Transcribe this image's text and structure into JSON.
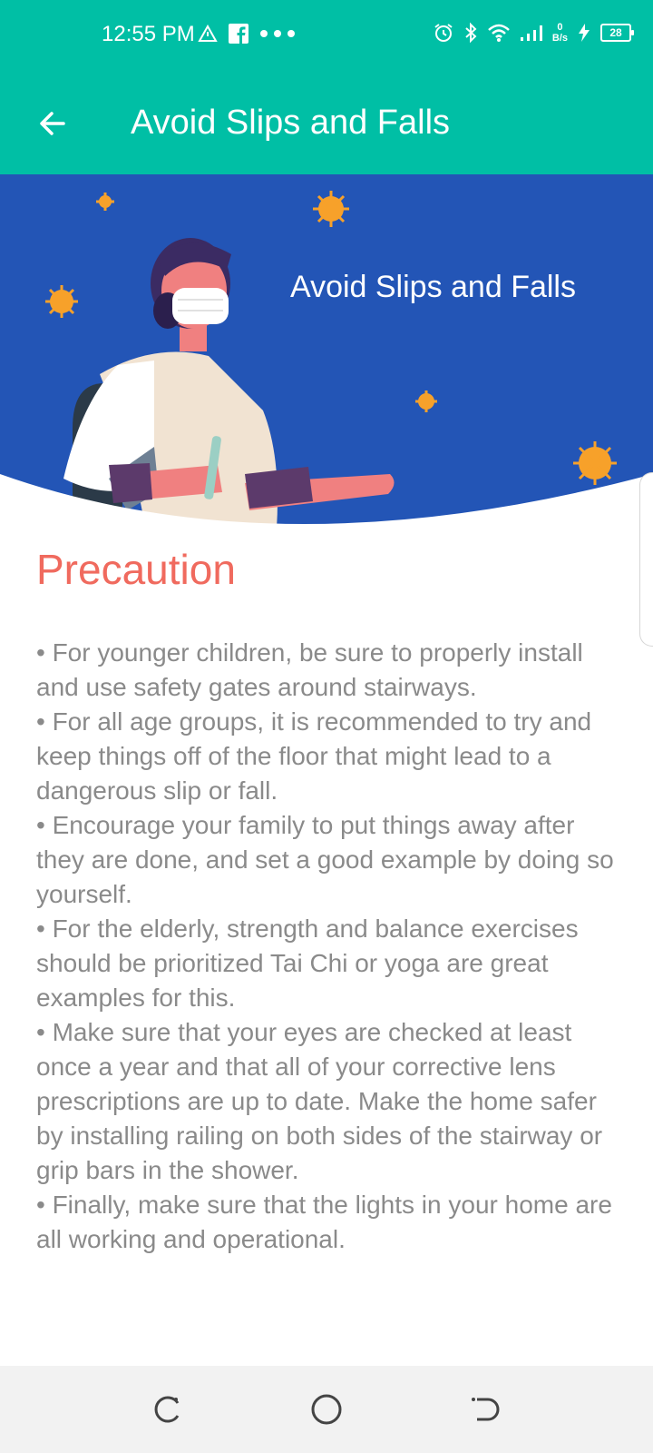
{
  "status_bar": {
    "time": "12:55 PM",
    "net_speed_value": "0",
    "net_speed_unit": "B/s",
    "battery": "28",
    "icons": [
      "warning-triangle-icon",
      "facebook-icon",
      "more-dots-icon",
      "alarm-icon",
      "bluetooth-icon",
      "wifi-icon",
      "signal-icon",
      "charging-icon",
      "battery-icon"
    ]
  },
  "app_bar": {
    "title": "Avoid Slips and Falls",
    "back_icon": "arrow-left-icon"
  },
  "banner": {
    "title": "Avoid Slips and Falls",
    "colors": {
      "background": "#2355b6",
      "virus": "#f7a12a"
    }
  },
  "content": {
    "heading": "Precaution",
    "body": "• For younger children, be sure to properly install and use safety gates around stairways.\n• For all age groups, it is recommended to try and keep things off of the floor that might lead to a dangerous slip or fall.\n• Encourage your family to put things away after they are done, and set a good example by doing so yourself.\n• For the elderly, strength and balance exercises should be prioritized Tai Chi or yoga are great examples for this.\n• Make sure that your eyes are checked at least once a year and that all of your corrective lens prescriptions are up to date. Make the home safer by installing railing on both sides of the stairway or grip bars in the shower.\n• Finally, make sure that the lights in your home are all working and operational."
  },
  "nav_bar": {
    "buttons": [
      "recents-icon",
      "home-icon",
      "back-icon"
    ]
  },
  "colors": {
    "accent": "#00bfa5",
    "heading": "#f06a5e",
    "body_text": "#8a8a8a",
    "nav_bg": "#f2f2f2"
  }
}
